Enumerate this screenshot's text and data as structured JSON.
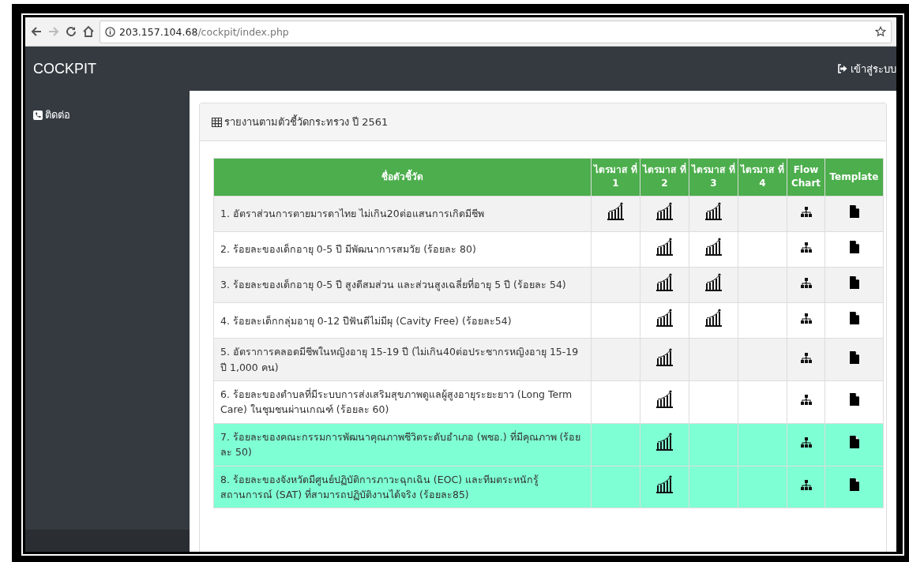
{
  "browser": {
    "url_host": "203.157.104.68",
    "url_path": "/cockpit/index.php"
  },
  "navbar": {
    "brand": "COCKPIT",
    "login": "เข้าสู่ระบบ"
  },
  "sidebar": {
    "items": [
      {
        "label": "ติดต่อ"
      }
    ]
  },
  "panel": {
    "title": "รายงานตามตัวชี้วัดกระทรวง ปี 2561"
  },
  "table": {
    "columns": [
      "ชื่อตัวชี้วัด",
      "ไตรมาส ที่ 1",
      "ไตรมาส ที่ 2",
      "ไตรมาส ที่ 3",
      "ไตรมาส ที่ 4",
      "Flow Chart",
      "Template"
    ],
    "rows": [
      {
        "name": "1. อัตราส่วนการตายมารดาไทย ไม่เกิน20ต่อแสนการเกิดมีชีพ",
        "highlighted": false,
        "quarters": [
          true,
          true,
          true,
          false
        ]
      },
      {
        "name": "2. ร้อยละของเด็กอายุ 0-5 ปี มีพัฒนาการสมวัย (ร้อยละ 80)",
        "highlighted": false,
        "quarters": [
          false,
          true,
          true,
          false
        ]
      },
      {
        "name": "3. ร้อยละของเด็กอายุ 0-5 ปี สูงดีสมส่วน และส่วนสูงเฉลี่ยที่อายุ 5 ปี (ร้อยละ 54)",
        "highlighted": false,
        "quarters": [
          false,
          true,
          true,
          false
        ]
      },
      {
        "name": "4. ร้อยละเด็กกลุ่มอายุ 0-12 ปีฟันดีไม่มีผุ (Cavity Free) (ร้อยละ54)",
        "highlighted": false,
        "quarters": [
          false,
          true,
          true,
          false
        ]
      },
      {
        "name": "5. อัตราการคลอดมีชีพในหญิงอายุ 15-19 ปี (ไม่เกิน40ต่อประชากรหญิงอายุ 15-19 ปี 1,000 คน)",
        "highlighted": false,
        "quarters": [
          false,
          true,
          false,
          false
        ]
      },
      {
        "name": "6. ร้อยละของตำบลที่มีระบบการส่งเสริมสุขภาพดูแลผู้สูงอายุระยะยาว (Long Term Care) ในชุมชนผ่านเกณฑ์ (ร้อยละ 60)",
        "highlighted": false,
        "quarters": [
          false,
          true,
          false,
          false
        ]
      },
      {
        "name": "7. ร้อยละของคณะกรรมการพัฒนาคุณภาพชีวิตระดับอำเภอ (พชอ.) ที่มีคุณภาพ (ร้อยละ 50)",
        "highlighted": true,
        "quarters": [
          false,
          true,
          false,
          false
        ]
      },
      {
        "name": "8. ร้อยละของจังหวัดมีศูนย์ปฏิบัติการภาวะฉุกเฉิน (EOC) และทีมตระหนักรู้สถานการณ์ (SAT) ที่สามารถปฏิบัติงานได้จริง (ร้อยละ85)",
        "highlighted": true,
        "quarters": [
          false,
          true,
          false,
          false
        ]
      }
    ]
  }
}
